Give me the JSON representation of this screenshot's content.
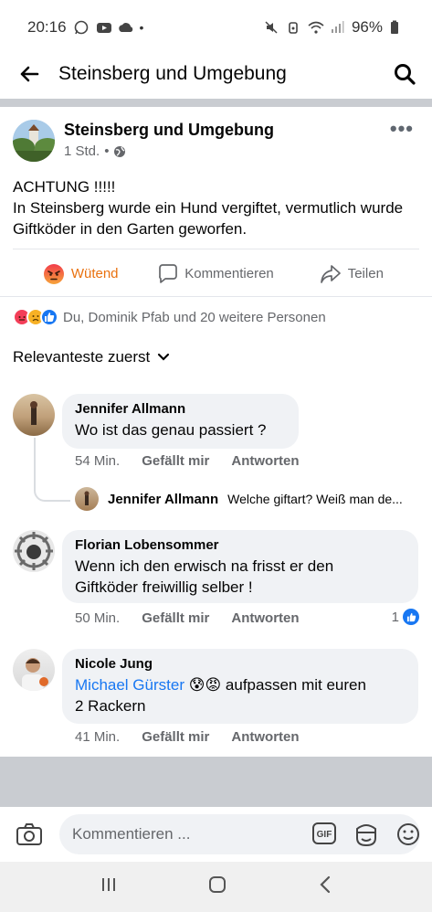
{
  "status": {
    "time": "20:16",
    "battery": "96%"
  },
  "appbar": {
    "title": "Steinsberg und Umgebung"
  },
  "post": {
    "group_name": "Steinsberg und Umgebung",
    "time": "1 Std.",
    "text_line1": "ACHTUNG !!!!!",
    "text_line2": "In Steinsberg wurde ein Hund vergiftet, vermutlich wurde Giftköder in den Garten geworfen."
  },
  "actions": {
    "react_label": "Wütend",
    "comment_label": "Kommentieren",
    "share_label": "Teilen"
  },
  "reactions": {
    "summary": "Du, Dominik Pfab und 20 weitere Personen"
  },
  "sort": {
    "label": "Relevanteste zuerst"
  },
  "comments": [
    {
      "name": "Jennifer Allmann",
      "text": "Wo ist das genau passiert ?",
      "time": "54 Min.",
      "like_label": "Gefällt mir",
      "reply_label": "Antworten",
      "reply": {
        "name": "Jennifer Allmann",
        "text": "Welche giftart? Weiß man de..."
      }
    },
    {
      "name": "Florian Lobensommer",
      "text_line1": "Wenn ich den erwisch na frisst er den",
      "text_line2": "Giftköder freiwillig selber !",
      "time": "50 Min.",
      "like_label": "Gefällt mir",
      "reply_label": "Antworten",
      "likes": "1"
    },
    {
      "name": "Nicole Jung",
      "mention": "Michael Gürster",
      "emojis": "😰😡",
      "text_after": "aufpassen mit euren",
      "text_line2": "2 Rackern",
      "time": "41 Min.",
      "like_label": "Gefällt mir",
      "reply_label": "Antworten"
    }
  ],
  "composer": {
    "placeholder": "Kommentieren ..."
  },
  "colors": {
    "facebook_blue": "#1877f2",
    "angry_orange": "#e9710f",
    "bubble_gray": "#f0f2f5",
    "meta_gray": "#65676b"
  },
  "icons": {
    "back": "arrow-left-icon",
    "search": "search-icon",
    "globe": "globe-icon",
    "comment": "speech-bubble-icon",
    "share": "share-arrow-icon",
    "camera": "camera-icon",
    "gif": "gif-icon",
    "sticker": "sticker-icon",
    "emoji": "smiley-icon"
  }
}
